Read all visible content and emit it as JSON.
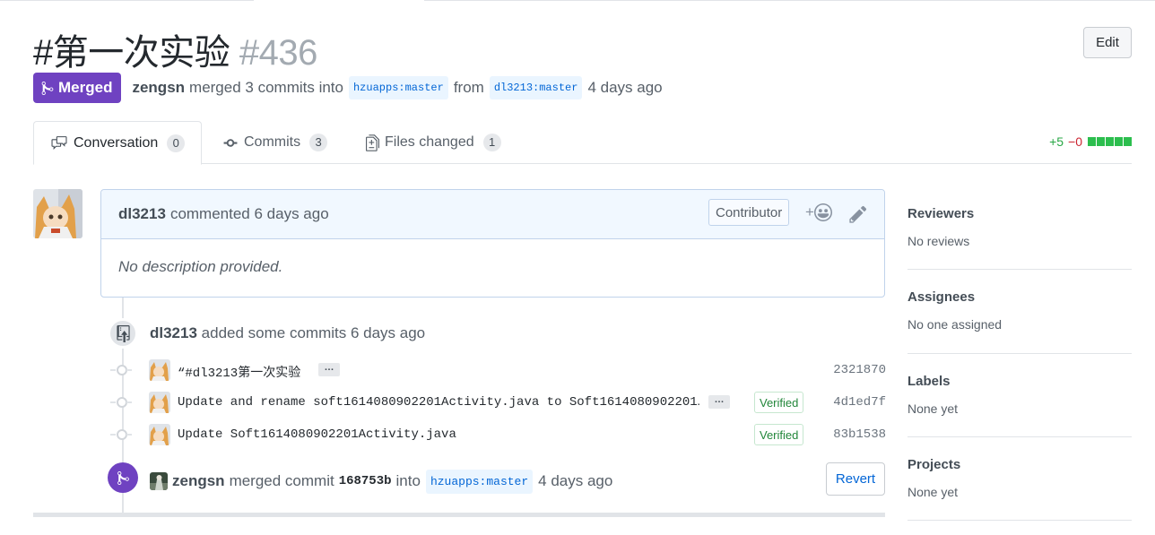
{
  "pr": {
    "title": "#第一次实验",
    "number": "#436",
    "state": "Merged",
    "author": "zengsn",
    "merge_summary": "merged 3 commits into",
    "base_branch": "hzuapps:master",
    "from_word": "from",
    "head_branch": "dl3213:master",
    "time_ago": "4 days ago",
    "edit_label": "Edit"
  },
  "tabs": [
    {
      "label": "Conversation",
      "count": "0"
    },
    {
      "label": "Commits",
      "count": "3"
    },
    {
      "label": "Files changed",
      "count": "1"
    }
  ],
  "diffstat": {
    "additions": "+5",
    "deletions": "−0"
  },
  "comment": {
    "author": "dl3213",
    "action": "commented 6 days ago",
    "role_badge": "Contributor",
    "reaction_plus": "+",
    "body": "No description provided."
  },
  "commit_event": {
    "author": "dl3213",
    "action": "added some commits 6 days ago"
  },
  "commits": [
    {
      "message": "“#dl3213第一次实验",
      "has_ellipsis": true,
      "ellipsis": "…",
      "verified": "",
      "sha": "2321870"
    },
    {
      "message": "Update and rename soft1614080902201Activity.java to Soft1614080902201…",
      "has_ellipsis": true,
      "ellipsis": "…",
      "verified": "Verified",
      "sha": "4d1ed7f"
    },
    {
      "message": "Update Soft1614080902201Activity.java",
      "has_ellipsis": false,
      "ellipsis": "",
      "verified": "Verified",
      "sha": "83b1538"
    }
  ],
  "merge_event": {
    "author": "zengsn",
    "action": "merged commit",
    "sha": "168753b",
    "into": "into",
    "branch": "hzuapps:master",
    "time_ago": "4 days ago",
    "revert_label": "Revert"
  },
  "sidebar": [
    {
      "heading": "Reviewers",
      "value": "No reviews"
    },
    {
      "heading": "Assignees",
      "value": "No one assigned"
    },
    {
      "heading": "Labels",
      "value": "None yet"
    },
    {
      "heading": "Projects",
      "value": "None yet"
    }
  ],
  "colors": {
    "merged": "#6f42c1",
    "link": "#0366d6",
    "added": "#28a745",
    "deleted": "#cb2431"
  }
}
